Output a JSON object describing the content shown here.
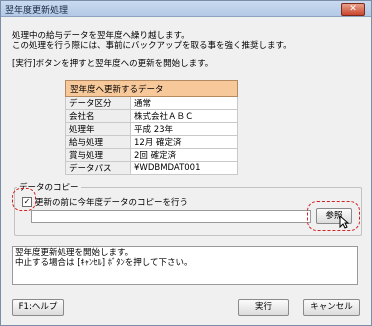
{
  "window": {
    "title": "翌年度更新処理",
    "close_label": "✕"
  },
  "intro": {
    "line1": "処理中の給与データを翌年度へ繰り越します。",
    "line2": "この処理を行う際には、事前にバックアップを取る事を強く推奨します。",
    "line3": "[実行]ボタンを押すと翌年度への更新を開始します。"
  },
  "update_table": {
    "header": "翌年度へ更新するデータ",
    "rows": [
      {
        "label": "データ区分",
        "value": "通常"
      },
      {
        "label": "会社名",
        "value": "株式会社ＡＢＣ"
      },
      {
        "label": "処理年",
        "value": "平成 23年"
      },
      {
        "label": "給与処理",
        "value": "12月 確定済"
      },
      {
        "label": "賞与処理",
        "value": "2回 確定済"
      },
      {
        "label": "データパス",
        "value": "¥WDBMDAT001"
      }
    ]
  },
  "copy_group": {
    "label": "データのコピー",
    "checkbox_label": "更新の前に今年度データのコピーを行う",
    "checked": true,
    "path_value": "",
    "browse_label": "参照"
  },
  "message": {
    "line1": "翌年度更新処理を開始します。",
    "line2": "中止する場合は [ｷｬﾝｾﾙ] ﾎﾞﾀﾝを押して下さい。"
  },
  "buttons": {
    "help": "F1:ヘルプ",
    "execute": "実行",
    "cancel": "キャンセル"
  },
  "colors": {
    "table_header": "#f7c99a",
    "highlight": "#d32020"
  }
}
